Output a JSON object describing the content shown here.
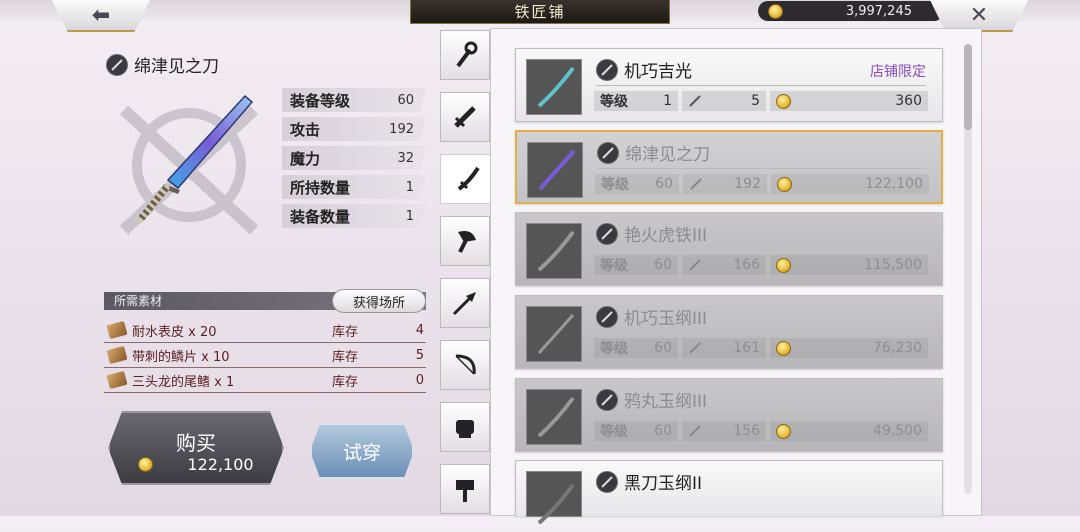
{
  "header": {
    "title": "铁匠铺",
    "gold": "3,997,245",
    "back_label": "⬅",
    "close_label": "✕"
  },
  "item": {
    "name": "绵津见之刀",
    "stats": [
      {
        "label": "装备等级",
        "value": "60"
      },
      {
        "label": "攻击",
        "value": "192"
      },
      {
        "label": "魔力",
        "value": "32"
      },
      {
        "label": "所持数量",
        "value": "1"
      },
      {
        "label": "装备数量",
        "value": "1"
      }
    ]
  },
  "materials": {
    "header": "所需素材",
    "source_button": "获得场所",
    "stock_label": "库存",
    "items": [
      {
        "name": "耐水表皮 x 20",
        "stock": "4"
      },
      {
        "name": "带刺的鳞片 x 10",
        "stock": "5"
      },
      {
        "name": "三头龙的尾鳍 x 1",
        "stock": "0"
      }
    ]
  },
  "actions": {
    "buy_label": "购买",
    "buy_price": "122,100",
    "try_label": "试穿"
  },
  "tabs": [
    "staff-icon",
    "sword-icon",
    "katana-icon",
    "axe-icon",
    "spear-icon",
    "bow-icon",
    "fist-icon",
    "hammer-icon"
  ],
  "list": {
    "level_label": "等级",
    "items": [
      {
        "name": "机巧吉光",
        "badge": "店铺限定",
        "level": "1",
        "atk": "5",
        "price": "360",
        "state": "normal"
      },
      {
        "name": "绵津见之刀",
        "badge": "",
        "level": "60",
        "atk": "192",
        "price": "122,100",
        "state": "selected"
      },
      {
        "name": "艳火虎铁III",
        "badge": "",
        "level": "60",
        "atk": "166",
        "price": "115,500",
        "state": "dim"
      },
      {
        "name": "机巧玉纲III",
        "badge": "",
        "level": "60",
        "atk": "161",
        "price": "76,230",
        "state": "dim"
      },
      {
        "name": "鸦丸玉纲III",
        "badge": "",
        "level": "60",
        "atk": "156",
        "price": "49,500",
        "state": "dim"
      },
      {
        "name": "黑刀玉纲II",
        "badge": "",
        "level": "",
        "atk": "",
        "price": "",
        "state": "normal"
      }
    ]
  }
}
